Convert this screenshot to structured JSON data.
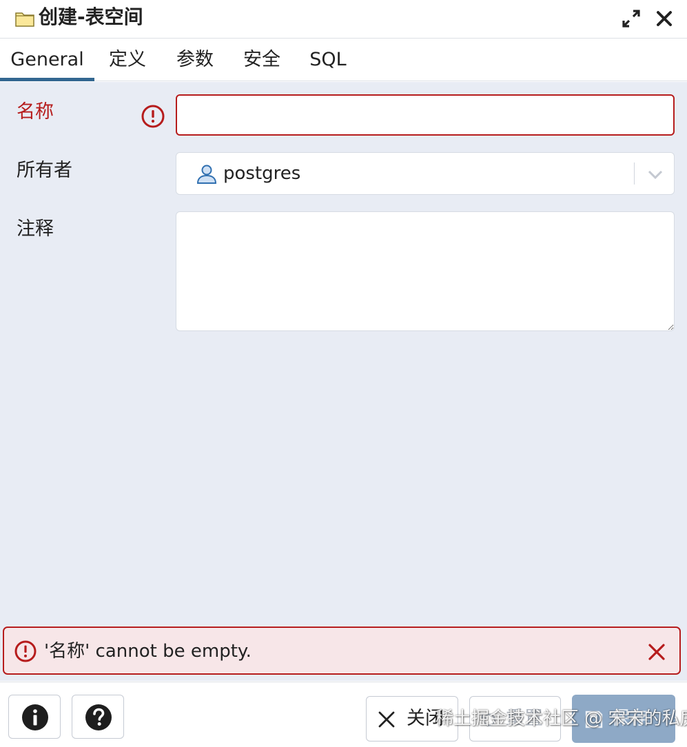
{
  "dialog": {
    "title": "创建-表空间",
    "title_icon": "folder-icon",
    "maximize_icon": "expand-icon",
    "close_icon": "close-icon"
  },
  "tabs": [
    {
      "label": "General",
      "active": true
    },
    {
      "label": "定义",
      "active": false
    },
    {
      "label": "参数",
      "active": false
    },
    {
      "label": "安全",
      "active": false
    },
    {
      "label": "SQL",
      "active": false
    }
  ],
  "form": {
    "name": {
      "label": "名称",
      "value": "",
      "error": true
    },
    "owner": {
      "label": "所有者",
      "value": "postgres",
      "icon": "user-icon"
    },
    "comment": {
      "label": "注释",
      "value": ""
    }
  },
  "error_banner": {
    "message": "'名称' cannot be empty.",
    "icon": "exclamation-circle-icon"
  },
  "footer": {
    "info_icon": "info-icon",
    "help_icon": "help-icon",
    "close_label": "关闭",
    "reset_label": "重置",
    "save_label": "保存"
  },
  "watermark": "稀土掘金技术社区 @ 宋宋的私房菜",
  "colors": {
    "accent": "#326690",
    "error": "#b61c1c",
    "error_bg": "#f7e6e8",
    "panel_bg": "#e8ecf4",
    "save_disabled": "#8ea9c6"
  }
}
